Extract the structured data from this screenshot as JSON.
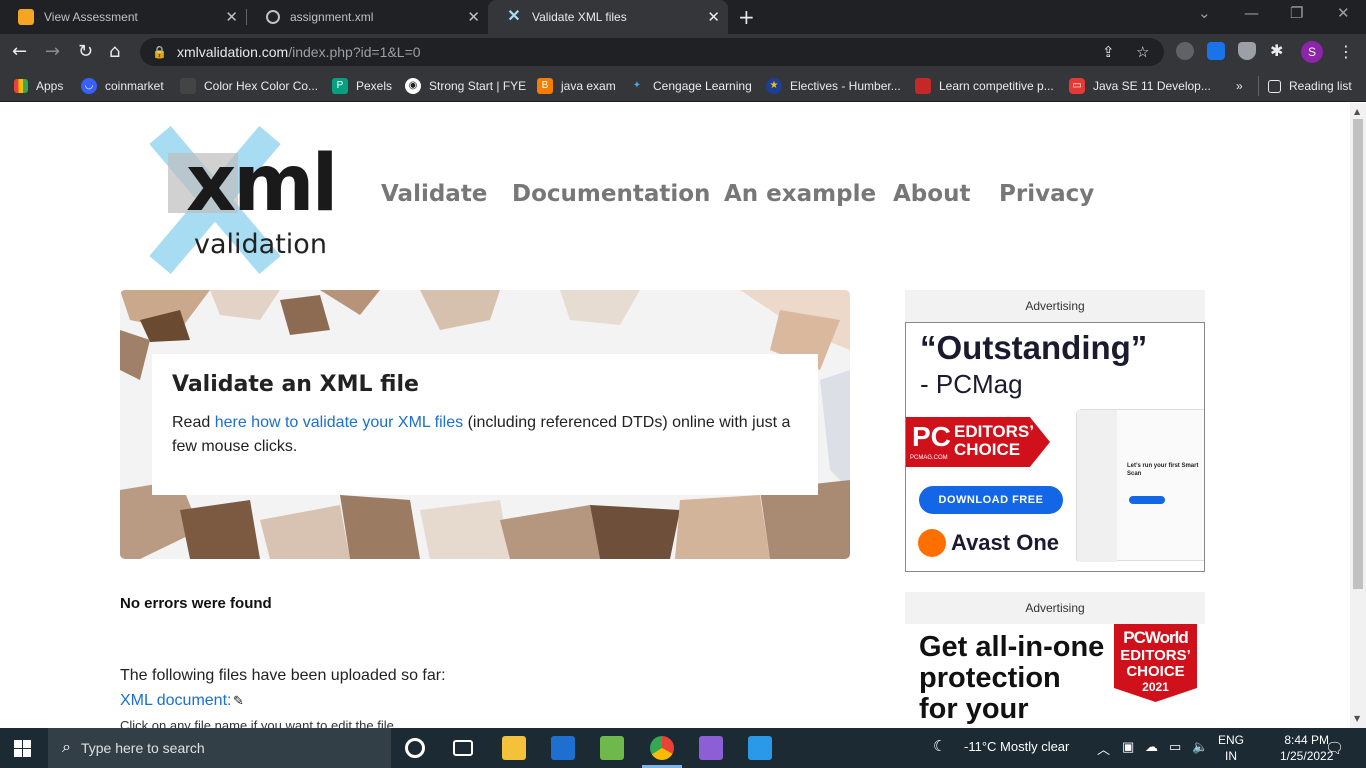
{
  "browser": {
    "tabs": [
      {
        "title": "View Assessment"
      },
      {
        "title": "assignment.xml"
      },
      {
        "title": "Validate XML files"
      }
    ],
    "url_host": "xmlvalidation.com",
    "url_path": "/index.php?id=1&L=0",
    "profile_initial": "S",
    "bookmarks": [
      {
        "label": "Apps"
      },
      {
        "label": "coinmarket"
      },
      {
        "label": "Color Hex Color Co..."
      },
      {
        "label": "Pexels"
      },
      {
        "label": "Strong Start | FYE"
      },
      {
        "label": "java exam"
      },
      {
        "label": "Cengage Learning"
      },
      {
        "label": "Electives - Humber..."
      },
      {
        "label": "Learn competitive p..."
      },
      {
        "label": "Java SE 11 Develop..."
      }
    ],
    "more_bookmarks": "»",
    "reading_list": "Reading list"
  },
  "site": {
    "logo_big": "xml",
    "logo_small": "validation",
    "nav": [
      "Validate",
      "Documentation",
      "An example",
      "About",
      "Privacy"
    ],
    "hero": {
      "title": "Validate an XML file",
      "text_before": "Read ",
      "link": "here how to validate your XML files",
      "text_after": " (including referenced DTDs) online with just a few mouse clicks."
    },
    "result": "No errors were found",
    "uploaded_text": "The following files have been uploaded so far:",
    "xml_doc_link": "XML document:",
    "click_hint": "Click on any file name if you want to edit the file."
  },
  "ads": {
    "label": "Advertising",
    "ad1": {
      "headline": "“Outstanding”",
      "sub": "- PCMag",
      "pc": "PC",
      "pc_sub": "PCMAG.COM",
      "editors": "EDITORS’",
      "choice": "CHOICE",
      "button": "DOWNLOAD FREE",
      "brand": "Avast One",
      "mock_title": "Let’s run your first Smart Scan"
    },
    "ad2": {
      "line1": "Get all-in-one",
      "line2": "protection",
      "line3": "for your",
      "badge1": "PCWorld",
      "badge2": "EDITORS’",
      "badge3": "CHOICE",
      "badge4": "2021"
    }
  },
  "taskbar": {
    "search_placeholder": "Type here to search",
    "weather": "-11°C  Mostly clear",
    "lang1": "ENG",
    "lang2": "IN",
    "time": "8:44 PM",
    "date": "1/25/2022"
  },
  "colors": {
    "link": "#1a6fd1",
    "nav": "#777777",
    "chrome_dark": "#202124",
    "chrome_toolbar": "#35363a",
    "logo_blue": "#a8dcf2"
  }
}
